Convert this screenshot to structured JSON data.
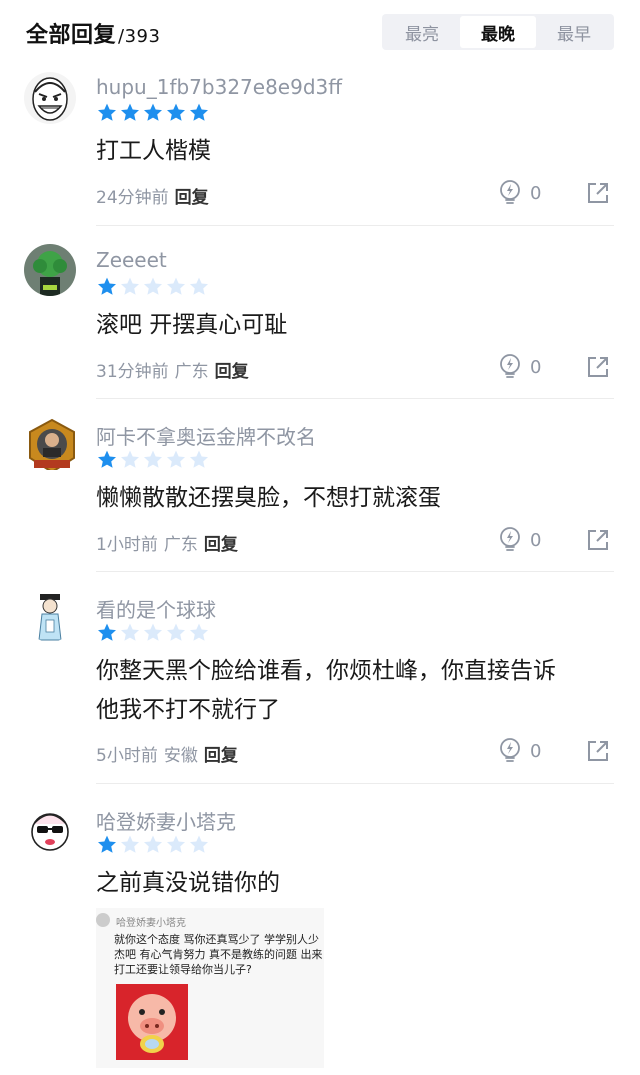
{
  "header": {
    "title": "全部回复",
    "count": "/393",
    "sort_tabs": [
      {
        "label": "最亮",
        "active": false
      },
      {
        "label": "最晚",
        "active": true
      },
      {
        "label": "最早",
        "active": false
      }
    ]
  },
  "comments": [
    {
      "username": "hupu_1fb7b327e8e9d3ff",
      "rating": 5,
      "content_lines": [
        "打工人楷模"
      ],
      "time": "24分钟前",
      "location": "",
      "reply_label": "回复",
      "likes": "0"
    },
    {
      "username": "Zeeeet",
      "rating": 1,
      "content_lines": [
        "滚吧 开摆真心可耻"
      ],
      "time": "31分钟前",
      "location": "广东",
      "reply_label": "回复",
      "likes": "0"
    },
    {
      "username": "阿卡不拿奥运金牌不改名",
      "rating": 1,
      "content_lines": [
        "懒懒散散还摆臭脸，不想打就滚蛋"
      ],
      "time": "1小时前",
      "location": "广东",
      "reply_label": "回复",
      "likes": "0"
    },
    {
      "username": "看的是个球球",
      "rating": 1,
      "content_lines": [
        "你整天黑个脸给谁看，你烦杜峰，你直接告诉",
        "他我不打不就行了"
      ],
      "time": "5小时前",
      "location": "安徽",
      "reply_label": "回复",
      "likes": "0"
    },
    {
      "username": "哈登娇妻小塔克",
      "rating": 1,
      "content_lines": [
        "之前真没说错你的"
      ],
      "embed": {
        "name": "哈登娇妻小塔克",
        "lines": [
          "就你这个态度 骂你还真骂少了 学学别人少",
          "杰吧 有心气肯努力 真不是教练的问题 出来",
          "打工还要让领导给你当儿子?"
        ]
      }
    }
  ],
  "colors": {
    "star_filled": "#1e8fee",
    "star_empty": "#dbeafb",
    "muted_text": "#8f96a3"
  }
}
